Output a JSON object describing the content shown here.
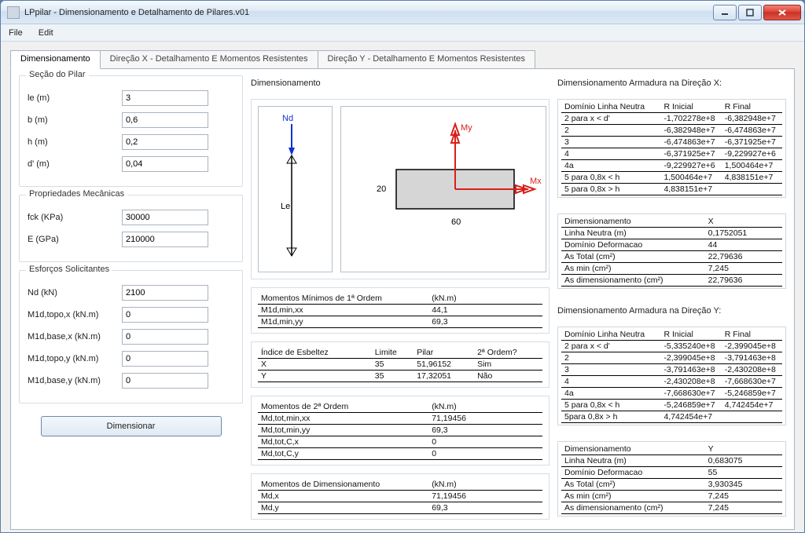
{
  "window": {
    "title": "LPpilar - Dimensionamento e Detalhamento de Pilares.v01"
  },
  "menu": {
    "file": "File",
    "edit": "Edit"
  },
  "tabs": {
    "t0": "Dimensionamento",
    "t1": "Direção X - Detalhamento E Momentos Resistentes",
    "t2": "Direção Y - Detalhamento E Momentos Resistentes"
  },
  "secao": {
    "legend": "Seção do Pilar",
    "le_lbl": "le (m)",
    "le": "3",
    "b_lbl": "b (m)",
    "b": "0,6",
    "h_lbl": "h (m)",
    "h": "0,2",
    "d_lbl": "d' (m)",
    "d": "0,04"
  },
  "prop": {
    "legend": "Propriedades Mecânicas",
    "fck_lbl": "fck (KPa)",
    "fck": "30000",
    "E_lbl": "E (GPa)",
    "E": "210000"
  },
  "esf": {
    "legend": "Esforços Solicitantes",
    "Nd_lbl": "Nd (kN)",
    "Nd": "2100",
    "M1tx_lbl": "M1d,topo,x (kN.m)",
    "M1tx": "0",
    "M1bx_lbl": "M1d,base,x (kN.m)",
    "M1bx": "0",
    "M1ty_lbl": "M1d,topo,y (kN.m)",
    "M1ty": "0",
    "M1by_lbl": "M1d,base,y (kN.m)",
    "M1by": "0"
  },
  "btn": {
    "dimensionar": "Dimensionar"
  },
  "dim": {
    "legend": "Dimensionamento",
    "nd_label": "Nd",
    "le_label": "Le",
    "my_label": "My",
    "mx_label": "Mx",
    "w_label": "60",
    "h_label": "20"
  },
  "mm1": {
    "title": "Momentos Mínimos de 1ª Ordem",
    "unit": "(kN.m)",
    "r1k": "M1d,min,xx",
    "r1v": "44,1",
    "r2k": "M1d,min,yy",
    "r2v": "69,3"
  },
  "esb": {
    "title": "Índice de Esbeltez",
    "c1": "Limite",
    "c2": "Pilar",
    "c3": "2ª Ordem?",
    "xk": "X",
    "xl": "35",
    "xp": "51,96152",
    "xo": "Sim",
    "yk": "Y",
    "yl": "35",
    "yp": "17,32051",
    "yo": "Não"
  },
  "m2": {
    "title": "Momentos de 2ª Ordem",
    "unit": "(kN.m)",
    "r1k": "Md,tot,min,xx",
    "r1v": "71,19456",
    "r2k": "Md,tot,min,yy",
    "r2v": "69,3",
    "r3k": "Md,tot,C,x",
    "r3v": "0",
    "r4k": "Md,tot,C,y",
    "r4v": "0"
  },
  "mdim": {
    "title": "Momentos de Dimensionamento",
    "unit": "(kN.m)",
    "r1k": "Md,x",
    "r1v": "71,19456",
    "r2k": "Md,y",
    "r2v": "69,3"
  },
  "armx": {
    "title": "Dimensionamento Armadura na Direção X:",
    "h1": "Domínio Linha Neutra",
    "h2": "R Inicial",
    "h3": "R Final",
    "rows": [
      {
        "a": "2 para x < d'",
        "b": "-1,702278e+8",
        "c": "-6,382948e+7"
      },
      {
        "a": "2",
        "b": "-6,382948e+7",
        "c": "-6,474863e+7"
      },
      {
        "a": "3",
        "b": "-6,474863e+7",
        "c": "-6,371925e+7"
      },
      {
        "a": "4",
        "b": "-6,371925e+7",
        "c": "-9,229927e+6"
      },
      {
        "a": "4a",
        "b": "-9,229927e+6",
        "c": "1,500464e+7"
      },
      {
        "a": "5 para 0,8x < h",
        "b": "1,500464e+7",
        "c": "4,838151e+7"
      },
      {
        "a": "5 para 0,8x > h",
        "b": "4,838151e+7",
        "c": ""
      }
    ],
    "dim_h": "Dimensionamento",
    "dim_x": "X",
    "ln_k": "Linha Neutra (m)",
    "ln_v": "0,1752051",
    "dd_k": "Domínio Deformacao",
    "dd_v": "44",
    "at_k": "As Total (cm²)",
    "at_v": "22,79636",
    "am_k": "As min (cm²)",
    "am_v": "7,245",
    "ad_k": "As dimensionamento (cm²)",
    "ad_v": "22,79636"
  },
  "army": {
    "title": "Dimensionamento Armadura na Direção Y:",
    "h1": "Domínio Linha Neutra",
    "h2": "R Inicial",
    "h3": "R Final",
    "rows": [
      {
        "a": "2 para x < d'",
        "b": "-5,335240e+8",
        "c": "-2,399045e+8"
      },
      {
        "a": "2",
        "b": "-2,399045e+8",
        "c": "-3,791463e+8"
      },
      {
        "a": "3",
        "b": "-3,791463e+8",
        "c": "-2,430208e+8"
      },
      {
        "a": "4",
        "b": "-2,430208e+8",
        "c": "-7,668630e+7"
      },
      {
        "a": "4a",
        "b": "-7,668630e+7",
        "c": "-5,246859e+7"
      },
      {
        "a": "5 para 0,8x < h",
        "b": "-5,246859e+7",
        "c": "4,742454e+7"
      },
      {
        "a": "5para 0,8x > h",
        "b": "4,742454e+7",
        "c": ""
      }
    ],
    "dim_h": "Dimensionamento",
    "dim_y": "Y",
    "ln_k": "Linha Neutra (m)",
    "ln_v": "0,683075",
    "dd_k": "Domínio Deformacao",
    "dd_v": "55",
    "at_k": "As Total (cm²)",
    "at_v": "3,930345",
    "am_k": "As min (cm²)",
    "am_v": "7,245",
    "ad_k": "As dimensionamento (cm²)",
    "ad_v": "7,245"
  }
}
